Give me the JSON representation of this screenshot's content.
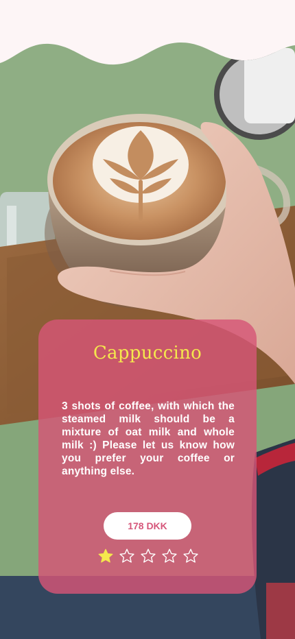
{
  "product": {
    "name": "Cappuccino",
    "description": "3 shots of coffee, with which the steamed milk should be a mixture of oat milk and whole milk :) Please let us know how you prefer your coffee or anything else.",
    "price": "178 DKK",
    "rating": {
      "value": 1,
      "max": 5
    }
  },
  "colors": {
    "background": "#fdf5f6",
    "card": "#d65676",
    "title": "#f5e84d",
    "price_text": "#d6567a",
    "star_filled": "#f5e84d",
    "star_empty_outline": "#ffffff"
  },
  "icons": {
    "star_filled": "star-filled-icon",
    "star_empty": "star-outline-icon"
  }
}
